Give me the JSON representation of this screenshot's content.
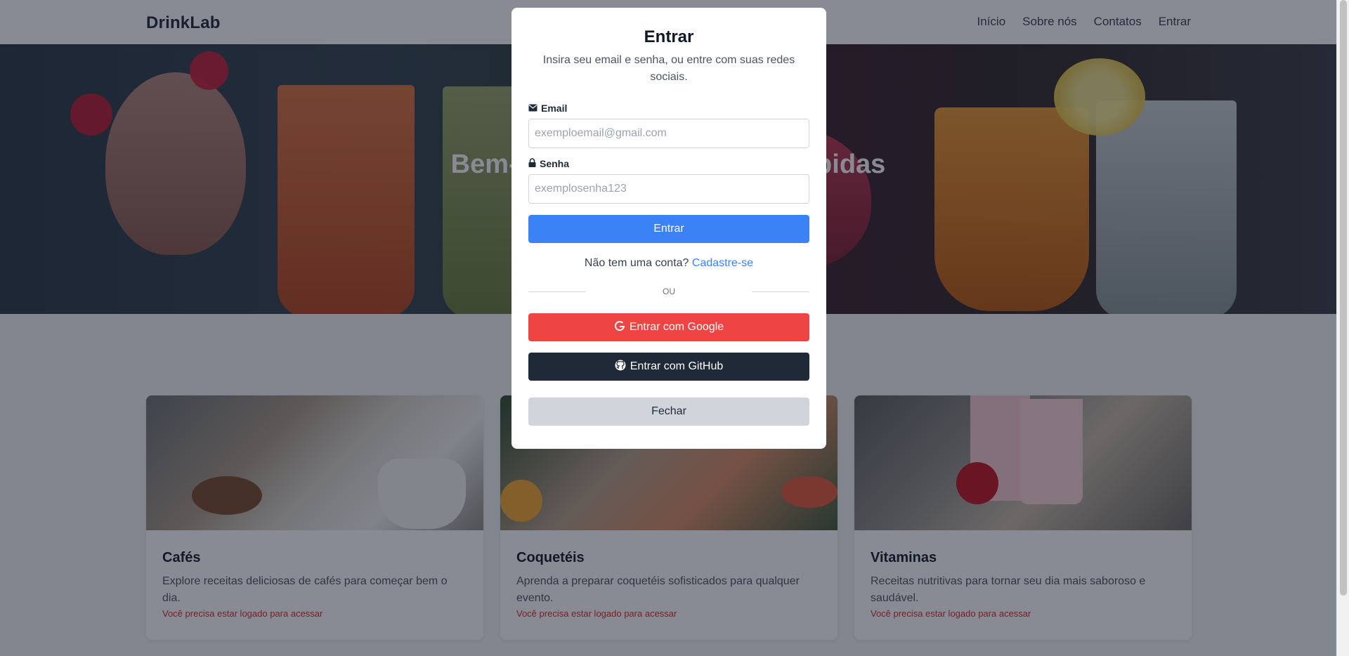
{
  "nav": {
    "brand": "DrinkLab",
    "links": [
      "Início",
      "Sobre nós",
      "Contatos",
      "Entrar"
    ]
  },
  "hero": {
    "title": "Bem-vindo ao mundo das bebidas"
  },
  "cards": [
    {
      "title": "Cafés",
      "description": "Explore receitas deliciosas de cafés para começar bem o dia.",
      "warning": "Você precisa estar logado para acessar"
    },
    {
      "title": "Coquetéis",
      "description": "Aprenda a preparar coquetéis sofisticados para qualquer evento.",
      "warning": "Você precisa estar logado para acessar"
    },
    {
      "title": "Vitaminas",
      "description": "Receitas nutritivas para tornar seu dia mais saboroso e saudável.",
      "warning": "Você precisa estar logado para acessar"
    }
  ],
  "modal": {
    "title": "Entrar",
    "subtitle": "Insira seu email e senha, ou entre com suas redes sociais.",
    "email_label": "Email",
    "email_placeholder": "exemploemail@gmail.com",
    "email_icon": "envelope-icon",
    "password_label": "Senha",
    "password_placeholder": "exemplosenha123",
    "password_icon": "lock-icon",
    "submit_label": "Entrar",
    "signup_prompt": "Não tem uma conta?",
    "signup_link": "Cadastre-se",
    "divider_text": "OU",
    "google_label": "Entrar com Google",
    "google_icon": "google-icon",
    "github_label": "Entrar com GitHub",
    "github_icon": "github-icon",
    "close_label": "Fechar"
  },
  "colors": {
    "primary": "#3b82f6",
    "google": "#ef4444",
    "github": "#1f2937",
    "warning": "#dc2626"
  }
}
